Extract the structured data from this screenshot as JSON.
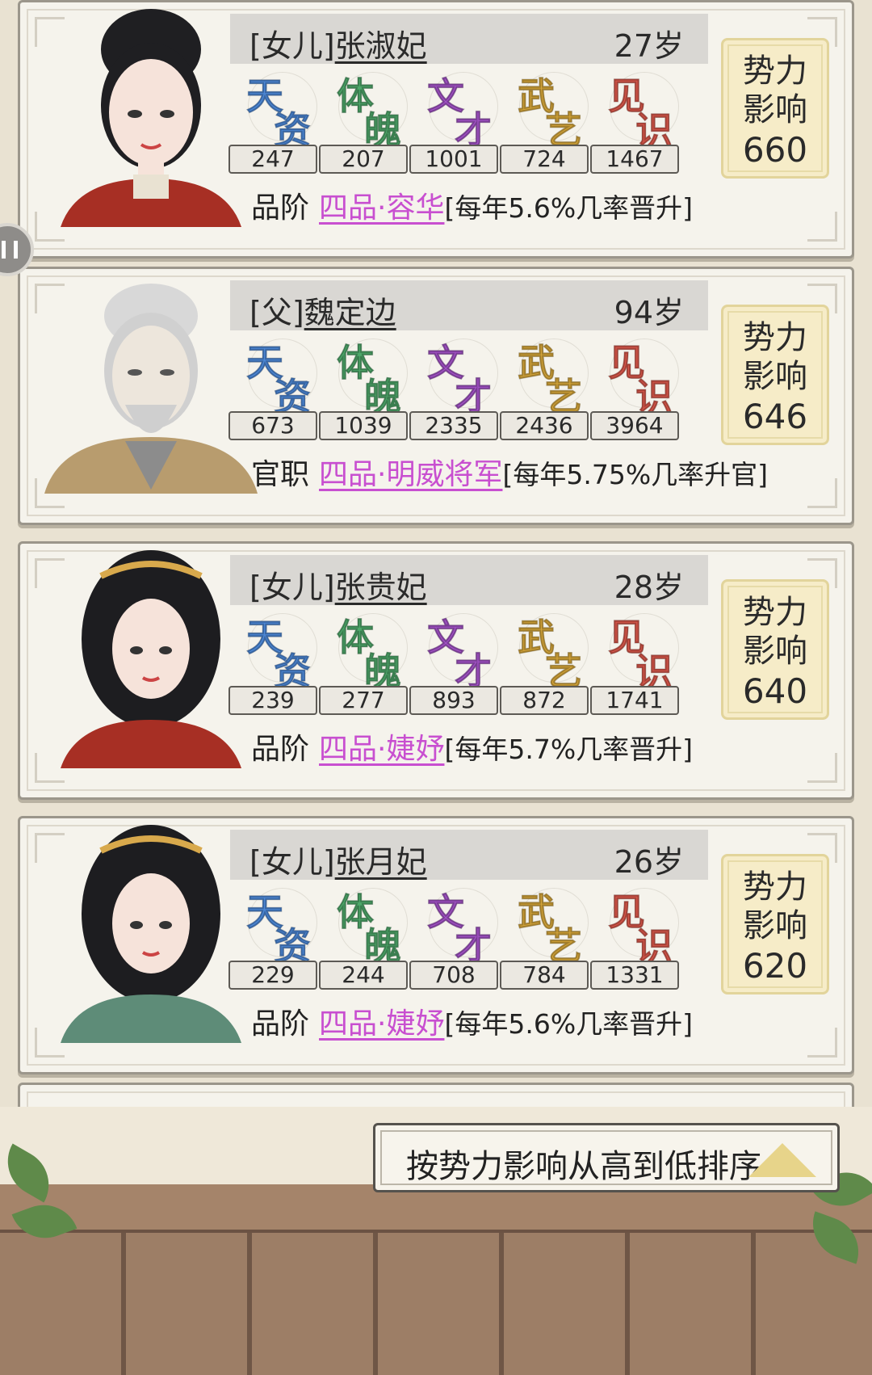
{
  "attr_labels": [
    {
      "c1": "天",
      "c2": "资",
      "color": "#4d89d8"
    },
    {
      "c1": "体",
      "c2": "魄",
      "color": "#4ea86a"
    },
    {
      "c1": "文",
      "c2": "才",
      "color": "#a252c6"
    },
    {
      "c1": "武",
      "c2": "艺",
      "color": "#d7a73a"
    },
    {
      "c1": "见",
      "c2": "识",
      "color": "#d9574a"
    }
  ],
  "cards": [
    {
      "relation": "[女儿]",
      "name": "张淑妃",
      "age": "27岁",
      "stats": [
        "247",
        "207",
        "1001",
        "724",
        "1467"
      ],
      "rank_label": "品阶",
      "rank_value": "四品·容华",
      "rank_note": "[每年5.6%几率晋升]",
      "power_label_1": "势力",
      "power_label_2": "影响",
      "power_value": "660",
      "portrait": "woman-red-robe"
    },
    {
      "relation": "[父]",
      "name": "魏定边",
      "age": "94岁",
      "stats": [
        "673",
        "1039",
        "2335",
        "2436",
        "3964"
      ],
      "rank_label": "官职",
      "rank_value": "四品·明威将军",
      "rank_note": "[每年5.75%几率升官]",
      "power_label_1": "势力",
      "power_label_2": "影响",
      "power_value": "646",
      "portrait": "elder-grey-hair"
    },
    {
      "relation": "[女儿]",
      "name": "张贵妃",
      "age": "28岁",
      "stats": [
        "239",
        "277",
        "893",
        "872",
        "1741"
      ],
      "rank_label": "品阶",
      "rank_value": "四品·婕妤",
      "rank_note": "[每年5.7%几率晋升]",
      "power_label_1": "势力",
      "power_label_2": "影响",
      "power_value": "640",
      "portrait": "woman-long-hair-red"
    },
    {
      "relation": "[女儿]",
      "name": "张月妃",
      "age": "26岁",
      "stats": [
        "229",
        "244",
        "708",
        "784",
        "1331"
      ],
      "rank_label": "品阶",
      "rank_value": "四品·婕妤",
      "rank_note": "[每年5.6%几率晋升]",
      "power_label_1": "势力",
      "power_label_2": "影响",
      "power_value": "620",
      "portrait": "woman-long-hair-green"
    }
  ],
  "sort_button": {
    "label": "按势力影响从高到低排序",
    "icon": "triangle-up-icon"
  }
}
